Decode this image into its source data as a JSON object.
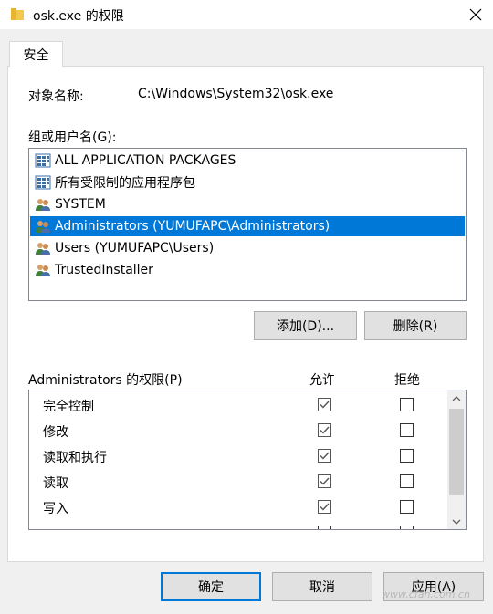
{
  "window": {
    "title": "osk.exe 的权限",
    "close_icon": "close-icon"
  },
  "tabs": [
    {
      "label": "安全",
      "active": true
    }
  ],
  "object": {
    "label": "对象名称:",
    "value": "C:\\Windows\\System32\\osk.exe"
  },
  "groups": {
    "label": "组或用户名(G):",
    "items": [
      {
        "label": "ALL APPLICATION PACKAGES",
        "icon": "app-package-icon",
        "selected": false
      },
      {
        "label": "所有受限制的应用程序包",
        "icon": "app-package-icon",
        "selected": false
      },
      {
        "label": "SYSTEM",
        "icon": "users-icon",
        "selected": false
      },
      {
        "label": "Administrators (YUMUFAPC\\Administrators)",
        "icon": "users-icon",
        "selected": true
      },
      {
        "label": "Users (YUMUFAPC\\Users)",
        "icon": "users-icon",
        "selected": false
      },
      {
        "label": "TrustedInstaller",
        "icon": "users-icon",
        "selected": false
      }
    ],
    "add_label": "添加(D)...",
    "remove_label": "删除(R)"
  },
  "permissions": {
    "header": "Administrators 的权限(P)",
    "allow_header": "允许",
    "deny_header": "拒绝",
    "rows": [
      {
        "name": "完全控制",
        "allow": true,
        "deny": false
      },
      {
        "name": "修改",
        "allow": true,
        "deny": false
      },
      {
        "name": "读取和执行",
        "allow": true,
        "deny": false
      },
      {
        "name": "读取",
        "allow": true,
        "deny": false
      },
      {
        "name": "写入",
        "allow": true,
        "deny": false
      }
    ]
  },
  "footer": {
    "ok_label": "确定",
    "cancel_label": "取消",
    "apply_label": "应用(A)"
  },
  "watermark": "www.cfan.com.cn",
  "colors": {
    "selection": "#0078d7",
    "dialog_bg": "#f0f0f0",
    "button_bg": "#e1e1e1"
  }
}
